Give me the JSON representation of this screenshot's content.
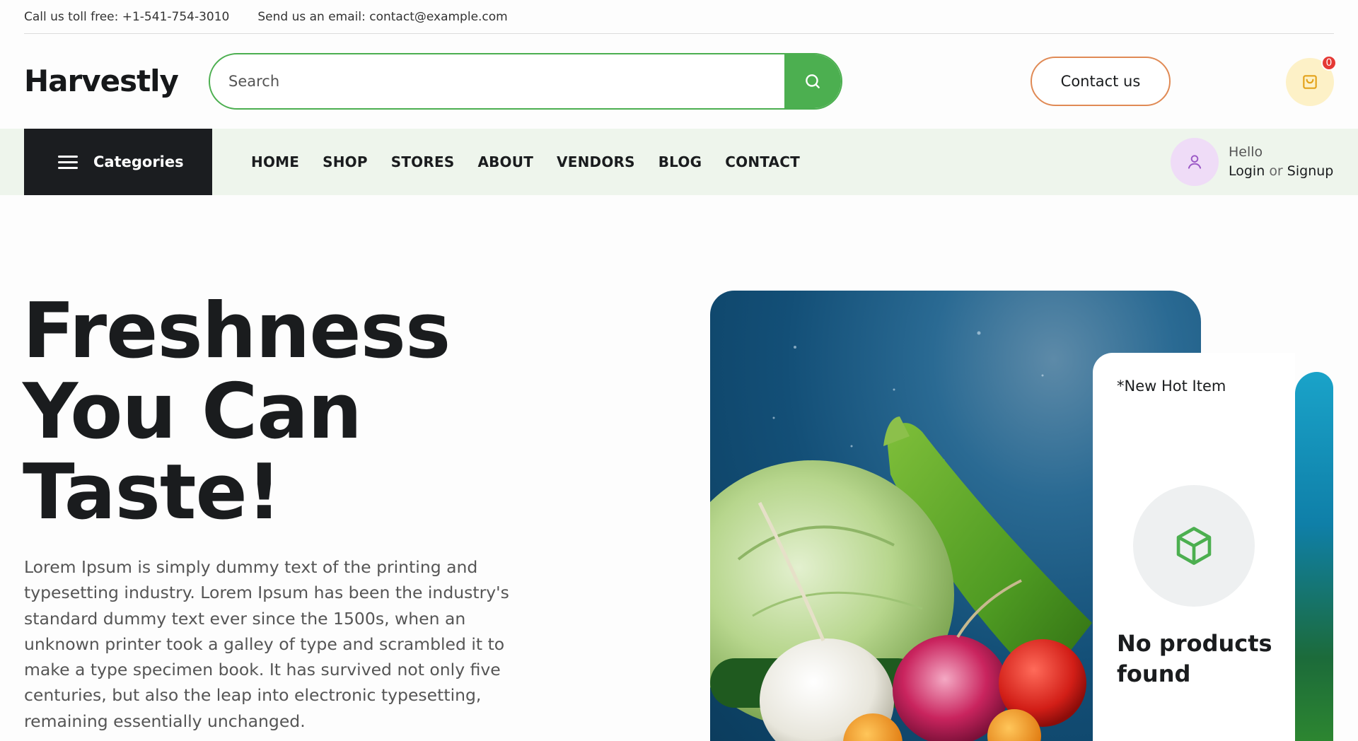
{
  "topbar": {
    "phone": "Call us toll free: +1-541-754-3010",
    "email": "Send us an email: contact@example.com"
  },
  "header": {
    "logo": "Harvestly",
    "search_placeholder": "Search",
    "contact_label": "Contact us",
    "cart_count": "0"
  },
  "navbar": {
    "categories_label": "Categories",
    "links": [
      "HOME",
      "SHOP",
      "STORES",
      "ABOUT",
      "VENDORS",
      "BLOG",
      "CONTACT"
    ],
    "user": {
      "greeting": "Hello",
      "login": "Login",
      "or": "or",
      "signup": "Signup"
    }
  },
  "hero": {
    "title_lines": [
      "Freshness",
      "You Can",
      "Taste!"
    ],
    "description": "Lorem Ipsum is simply dummy text of the printing and typesetting industry. Lorem Ipsum has been the industry's standard dummy text ever since the 1500s, when an unknown printer took a galley of type and scrambled it to make a type specimen book. It has survived not only five centuries, but also the leap into electronic typesetting, remaining essentially unchanged."
  },
  "hot_item": {
    "label": "*New Hot Item",
    "empty_message": "No products found"
  },
  "colors": {
    "accent_green": "#4caf50",
    "contact_border": "#e08a55",
    "cart_bg": "#fdf1c7",
    "badge_red": "#e53935",
    "navbar_bg": "#eef5ec",
    "categories_bg": "#1b1d20",
    "avatar_bg": "#efdcf7"
  },
  "icons": {
    "search": "search-icon",
    "cart": "shopping-bag-icon",
    "menu": "hamburger-icon",
    "user": "user-icon",
    "box": "box-icon"
  }
}
